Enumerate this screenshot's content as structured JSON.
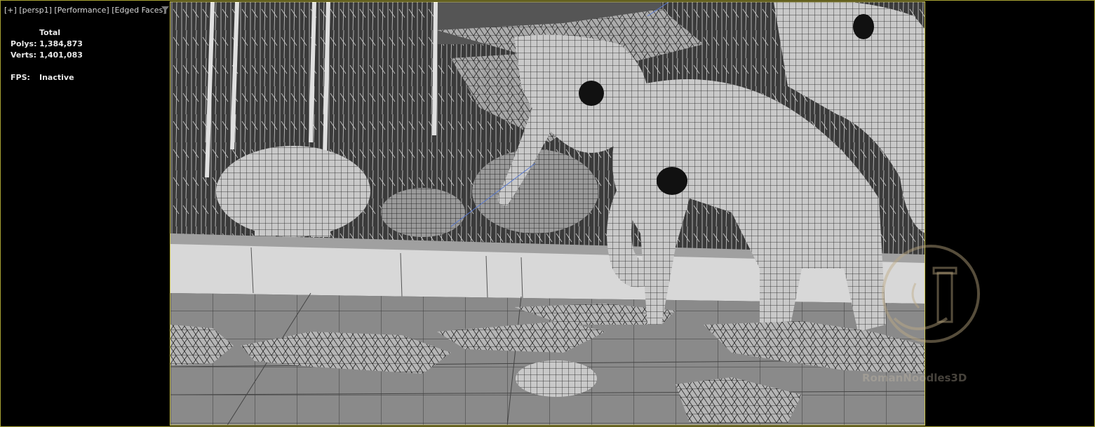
{
  "viewport": {
    "label_plus": "[+]",
    "label_view": "[persp1]",
    "label_mode": "[Performance]",
    "label_shading": "[Edged Faces]"
  },
  "stats": {
    "header": "Total",
    "polys_label": "Polys:",
    "polys_value": "1,384,873",
    "verts_label": "Verts:",
    "verts_value": "1,401,083",
    "fps_label": "FPS:",
    "fps_value": "Inactive"
  },
  "watermark": {
    "text": "RomanNoodles3D"
  },
  "colors": {
    "background": "#000000",
    "border_accent": "#c9c24a",
    "label_text": "#d8d8d8"
  }
}
